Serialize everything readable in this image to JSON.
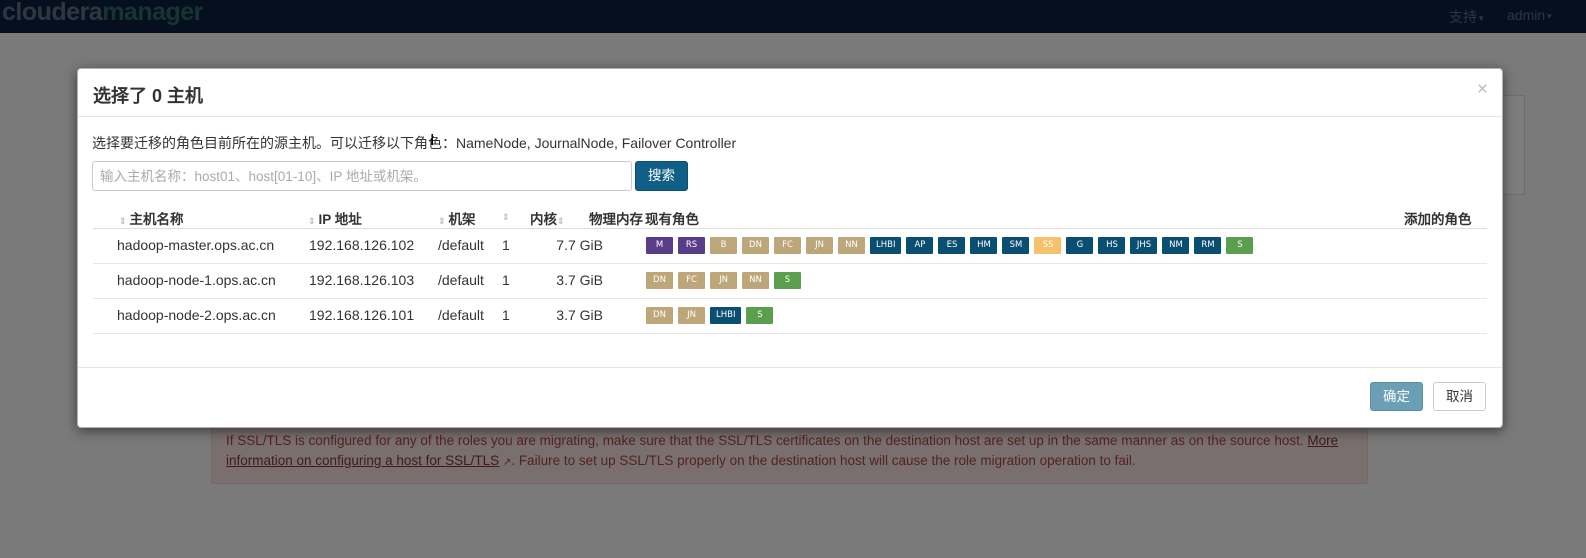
{
  "app": {
    "logo_part1": "cloudera",
    "logo_part2": "manager",
    "menu_support": "支持",
    "menu_admin": "admin",
    "caret": "▾"
  },
  "alert": {
    "text_before": "If SSL/TLS is configured for any of the roles you are migrating, make sure that the SSL/TLS certificates on the destination host are set up in the same manner as on the source host. ",
    "link_text": "More information on configuring a host for SSL/TLS",
    "link_icon": "↗",
    "text_after": ". Failure to set up SSL/TLS properly on the destination host will cause the role migration operation to fail."
  },
  "modal": {
    "title": "选择了 0 主机",
    "close_glyph": "×",
    "description": "选择要迁移的角色目前所在的源主机。可以迁移以下角色：NameNode, JournalNode, Failover Controller",
    "search_placeholder": "输入主机名称：host01、host[01-10]、IP 地址或机架。",
    "search_button": "搜索",
    "columns": {
      "hostname": "主机名称",
      "ip": "IP 地址",
      "rack": "机架",
      "cores": "内核",
      "memory": "物理内存",
      "existing_roles": "现有角色",
      "added_roles": "添加的角色"
    },
    "sort_glyph": "⇕",
    "rows": [
      {
        "hostname": "hadoop-master.ops.ac.cn",
        "ip": "192.168.126.102",
        "rack": "/default",
        "cores": "1",
        "memory": "7.7 GiB",
        "roles": [
          {
            "label": "M",
            "color": "#5b3c88"
          },
          {
            "label": "RS",
            "color": "#5b3c88"
          },
          {
            "label": "B",
            "color": "#bda77a"
          },
          {
            "label": "DN",
            "color": "#bda77a"
          },
          {
            "label": "FC",
            "color": "#bda77a"
          },
          {
            "label": "JN",
            "color": "#bda77a"
          },
          {
            "label": "NN",
            "color": "#bda77a"
          },
          {
            "label": "LHBI",
            "color": "#0a4e72"
          },
          {
            "label": "AP",
            "color": "#0a4e72"
          },
          {
            "label": "ES",
            "color": "#0a4e72"
          },
          {
            "label": "HM",
            "color": "#0a4e72"
          },
          {
            "label": "SM",
            "color": "#0a4e72"
          },
          {
            "label": "SS",
            "color": "#f5c26b"
          },
          {
            "label": "G",
            "color": "#0a4e72"
          },
          {
            "label": "HS",
            "color": "#0a4e72"
          },
          {
            "label": "JHS",
            "color": "#0a4e72"
          },
          {
            "label": "NM",
            "color": "#0a4e72"
          },
          {
            "label": "RM",
            "color": "#0a4e72"
          },
          {
            "label": "S",
            "color": "#5b9e4d"
          }
        ]
      },
      {
        "hostname": "hadoop-node-1.ops.ac.cn",
        "ip": "192.168.126.103",
        "rack": "/default",
        "cores": "1",
        "memory": "3.7 GiB",
        "roles": [
          {
            "label": "DN",
            "color": "#bda77a"
          },
          {
            "label": "FC",
            "color": "#bda77a"
          },
          {
            "label": "JN",
            "color": "#bda77a"
          },
          {
            "label": "NN",
            "color": "#bda77a"
          },
          {
            "label": "S",
            "color": "#5b9e4d"
          }
        ]
      },
      {
        "hostname": "hadoop-node-2.ops.ac.cn",
        "ip": "192.168.126.101",
        "rack": "/default",
        "cores": "1",
        "memory": "3.7 GiB",
        "roles": [
          {
            "label": "DN",
            "color": "#bda77a"
          },
          {
            "label": "JN",
            "color": "#bda77a"
          },
          {
            "label": "LHBI",
            "color": "#0a4e72"
          },
          {
            "label": "S",
            "color": "#5b9e4d"
          }
        ]
      }
    ],
    "ok_button": "确定",
    "cancel_button": "取消"
  }
}
